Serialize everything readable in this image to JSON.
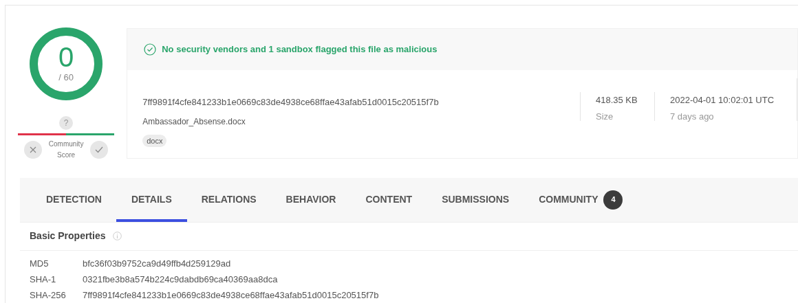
{
  "score": {
    "detections": "0",
    "total": "/ 60"
  },
  "community_score": {
    "value": "?",
    "label": "Community Score"
  },
  "banner": {
    "malicious": false,
    "message": "No security vendors and 1 sandbox flagged this file as malicious"
  },
  "file": {
    "hash": "7ff9891f4cfe841233b1e0669c83de4938ce68ffae43afab51d0015c20515f7b",
    "name": "Ambassador_Absense.docx",
    "tags": [
      "docx"
    ],
    "size": "418.35 KB",
    "size_label": "Size",
    "date": "2022-04-01 10:02:01 UTC",
    "date_relative": "7 days ago"
  },
  "tabs": [
    {
      "label": "DETECTION",
      "selected": false
    },
    {
      "label": "DETAILS",
      "selected": true
    },
    {
      "label": "RELATIONS",
      "selected": false
    },
    {
      "label": "BEHAVIOR",
      "selected": false
    },
    {
      "label": "CONTENT",
      "selected": false
    },
    {
      "label": "SUBMISSIONS",
      "selected": false
    },
    {
      "label": "COMMUNITY",
      "selected": false,
      "badge": "4"
    }
  ],
  "basic_properties": {
    "title": "Basic Properties",
    "rows": [
      {
        "key": "MD5",
        "value": "bfc36f03b9752ca9d49ffb4d259129ad"
      },
      {
        "key": "SHA-1",
        "value": "0321fbe3b8a574b224c9dabdb69ca40369aa8dca"
      },
      {
        "key": "SHA-256",
        "value": "7ff9891f4cfe841233b1e0669c83de4938ce68ffae43afab51d0015c20515f7b"
      }
    ]
  }
}
